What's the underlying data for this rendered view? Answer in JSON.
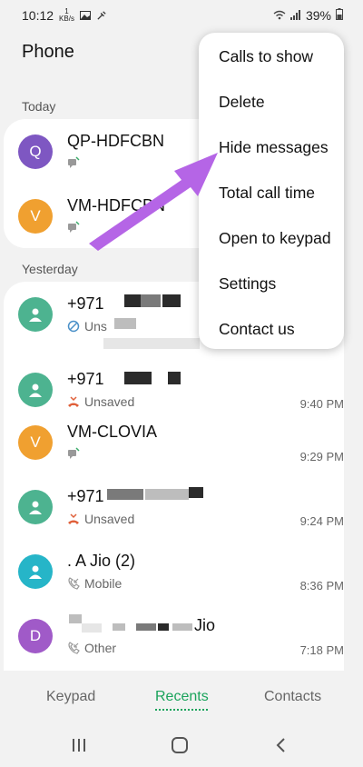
{
  "status_bar": {
    "time": "10:12",
    "net_speed_value": "1",
    "net_speed_unit": "KB/s",
    "battery": "39%"
  },
  "header": {
    "title": "Phone"
  },
  "sections": {
    "today": "Today",
    "yesterday": "Yesterday"
  },
  "today_calls": [
    {
      "name": "QP-HDFCBN",
      "avatar_letter": "Q",
      "avatar_color": "#7e57c2"
    },
    {
      "name": "VM-HDFCBN",
      "avatar_letter": "V",
      "avatar_color": "#f0a030"
    }
  ],
  "yesterday_calls": [
    {
      "name": "+971",
      "sub": "Uns",
      "time": "",
      "avatar_color": "#4db390"
    },
    {
      "name": "+971",
      "sub": "Unsaved",
      "time": "9:40 PM",
      "avatar_color": "#4db390"
    },
    {
      "name": "VM-CLOVIA",
      "avatar_letter": "V",
      "sub": "",
      "time": "9:29 PM",
      "avatar_color": "#f0a030"
    },
    {
      "name": "+971",
      "sub": "Unsaved",
      "time": "9:24 PM",
      "avatar_color": "#4db390"
    },
    {
      "name": ". A Jio (2)",
      "sub": "Mobile",
      "time": "8:36 PM",
      "avatar_color": "#26b5c8"
    },
    {
      "name": "Jio",
      "avatar_letter": "D",
      "sub": "Other",
      "time": "7:18 PM",
      "avatar_color": "#a05ac8"
    }
  ],
  "menu": {
    "items": [
      "Calls to show",
      "Delete",
      "Hide messages",
      "Total call time",
      "Open to keypad",
      "Settings",
      "Contact us"
    ]
  },
  "tabs": {
    "keypad": "Keypad",
    "recents": "Recents",
    "contacts": "Contacts",
    "active_color": "#1aa35b"
  },
  "annotation": {
    "arrow_color": "#b565e6"
  }
}
